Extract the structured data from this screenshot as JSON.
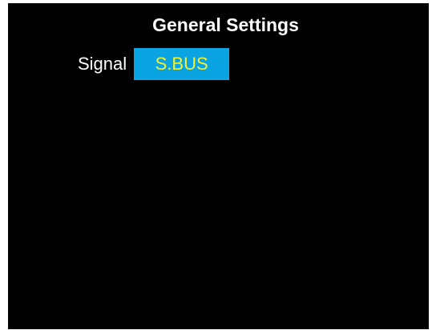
{
  "screen": {
    "title": "General Settings"
  },
  "settings": {
    "signal": {
      "label": "Signal",
      "value": "S.BUS"
    }
  },
  "colors": {
    "background": "#000000",
    "text": "#ffffff",
    "selected_bg": "#0aa4e3",
    "selected_text": "#f4f230"
  }
}
